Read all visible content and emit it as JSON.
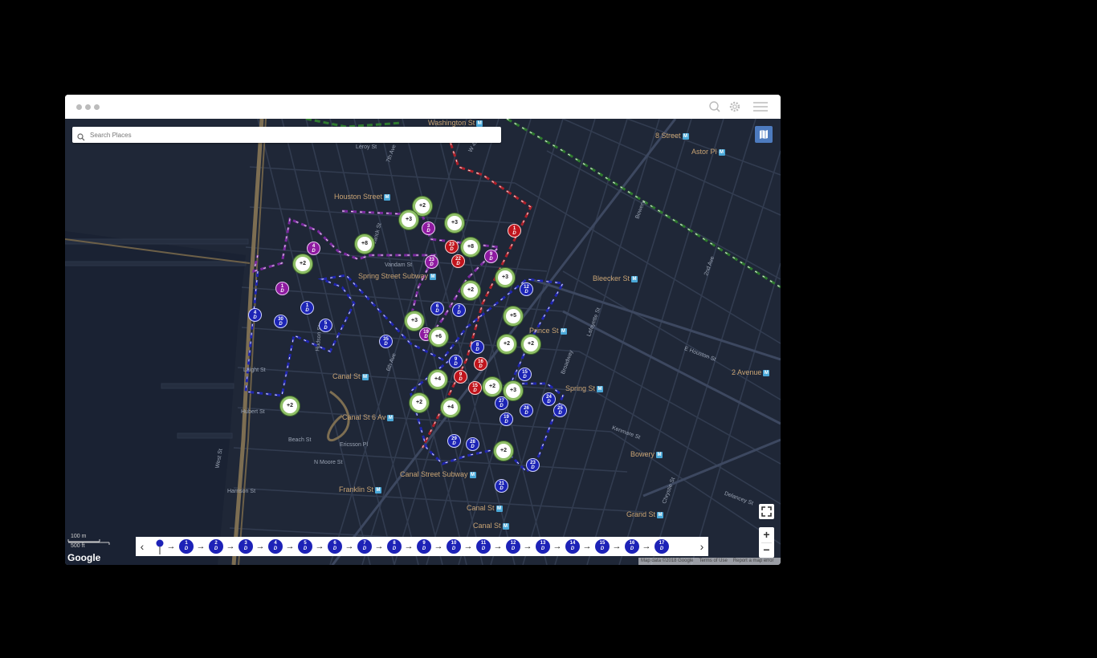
{
  "window": {
    "dots": [
      "",
      "",
      ""
    ]
  },
  "toolbar": {
    "icons": [
      "search-icon",
      "gear-icon",
      "hamburger-menu-icon"
    ]
  },
  "search": {
    "placeholder": "Search Places"
  },
  "map": {
    "theme_colors": {
      "background": "#1f2737",
      "water": "#1a2233",
      "highway": "#8a7a5a",
      "stop_blue": "#1c24b5",
      "stop_red": "#c0141c",
      "stop_purple": "#8e1aa0",
      "cluster_ring": "#8fbf67"
    },
    "labels": {
      "washington_st": "Washington St",
      "houston_st": "Houston Street",
      "spring_st_subway": "Spring Street Subway",
      "canal_st": "Canal St",
      "canal_st_6av": "Canal St 6 Av",
      "canal_street_subway": "Canal Street Subway",
      "canal_st_2": "Canal St",
      "canal_st_3": "Canal St",
      "franklin_st": "Franklin St",
      "bleecker_st": "Bleecker St",
      "prince_st": "Prince St",
      "spring_st": "Spring St",
      "bowery": "Bowery",
      "grand_st": "Grand St",
      "8_street": "8 Street",
      "astor_pl": "Astor Pl",
      "2_avenue": "2 Avenue",
      "west_st": "West St",
      "hudson_st": "Hudson St",
      "varick_st": "Varick St",
      "vandam_st": "Vandam St",
      "laight_st": "Laight St",
      "hubert_st": "Hubert St",
      "beach_st": "Beach St",
      "ericsson_pl": "Ericsson Pl",
      "n_moore_st": "N Moore St",
      "harrison_st": "Harrison St",
      "broadway": "Broadway",
      "lafayette_st": "Lafayette St",
      "e_houston_st": "E Houston St",
      "kenmare_st": "Kenmare St",
      "delancey_st": "Delancey St",
      "2nd_ave": "2nd Ave",
      "bowery_st": "Bowery",
      "chrystie_st": "Chrystie St",
      "leroy_st": "Leroy St",
      "7th_ave": "7th Ave",
      "6th_ave": "6th Ave",
      "w_4th": "W 4th"
    },
    "markers": {
      "blue": [
        {
          "n": "1",
          "d": "D"
        },
        {
          "n": "4",
          "d": "D"
        },
        {
          "n": "30",
          "d": "D"
        },
        {
          "n": "5",
          "d": "D"
        },
        {
          "n": "6",
          "d": "D"
        },
        {
          "n": "7",
          "d": "D"
        },
        {
          "n": "12",
          "d": "D"
        },
        {
          "n": "35",
          "d": "D"
        },
        {
          "n": "8",
          "d": "D"
        },
        {
          "n": "9",
          "d": "D"
        },
        {
          "n": "15",
          "d": "D"
        },
        {
          "n": "24",
          "d": "D"
        },
        {
          "n": "27",
          "d": "D"
        },
        {
          "n": "26",
          "d": "D"
        },
        {
          "n": "25",
          "d": "D"
        },
        {
          "n": "19",
          "d": "D"
        },
        {
          "n": "29",
          "d": "D"
        },
        {
          "n": "28",
          "d": "D"
        },
        {
          "n": "23",
          "d": "D"
        },
        {
          "n": "21",
          "d": "D"
        }
      ],
      "red": [
        {
          "n": "1",
          "d": "D"
        },
        {
          "n": "23",
          "d": "D"
        },
        {
          "n": "22",
          "d": "D"
        },
        {
          "n": "16",
          "d": "D"
        },
        {
          "n": "9",
          "d": "D"
        },
        {
          "n": "15",
          "d": "D"
        }
      ],
      "purple": [
        {
          "n": "4",
          "d": "D"
        },
        {
          "n": "1",
          "d": "D"
        },
        {
          "n": "3",
          "d": "D"
        },
        {
          "n": "23",
          "d": "D"
        },
        {
          "n": "9",
          "d": "D"
        },
        {
          "n": "19",
          "d": "D"
        }
      ],
      "clusters": [
        "+2",
        "+3",
        "+3",
        "+8",
        "+8",
        "+2",
        "+2",
        "+3",
        "+5",
        "+3",
        "+6",
        "+2",
        "+2",
        "+4",
        "+3",
        "+2",
        "+2",
        "+4",
        "+2",
        "+2"
      ]
    },
    "scale": {
      "metric": "100 m",
      "imperial": "500 ft"
    },
    "logo": "Google",
    "attribution": [
      "Map data ©2018 Google",
      "Terms of Use",
      "Report a map error"
    ],
    "controls": {
      "zoom_in": "+",
      "zoom_out": "−",
      "prev": "‹",
      "next": "›"
    }
  },
  "timeline": {
    "stops": [
      {
        "n": "1",
        "d": "D"
      },
      {
        "n": "2",
        "d": "D"
      },
      {
        "n": "3",
        "d": "D"
      },
      {
        "n": "4",
        "d": "D"
      },
      {
        "n": "5",
        "d": "D"
      },
      {
        "n": "6",
        "d": "D"
      },
      {
        "n": "7",
        "d": "D"
      },
      {
        "n": "8",
        "d": "D"
      },
      {
        "n": "9",
        "d": "D"
      },
      {
        "n": "10",
        "d": "D"
      },
      {
        "n": "11",
        "d": "D"
      },
      {
        "n": "12",
        "d": "D"
      },
      {
        "n": "13",
        "d": "D"
      },
      {
        "n": "14",
        "d": "D"
      },
      {
        "n": "15",
        "d": "D"
      },
      {
        "n": "16",
        "d": "D"
      },
      {
        "n": "17",
        "d": "D"
      }
    ],
    "arrow": "→"
  }
}
